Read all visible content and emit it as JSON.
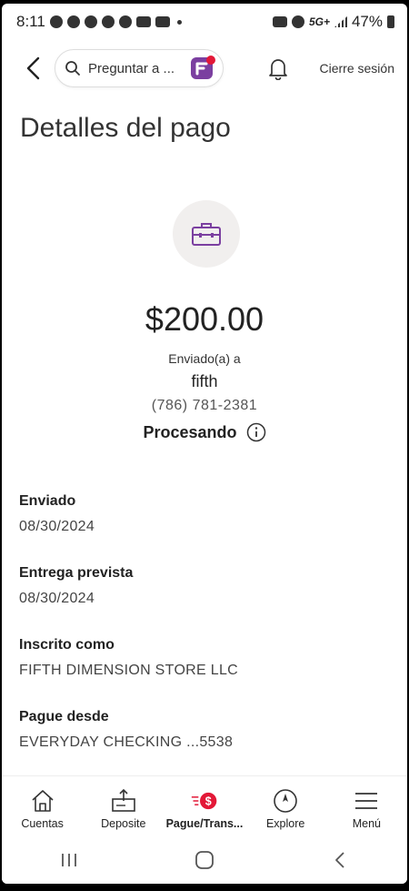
{
  "status_bar": {
    "time": "8:11",
    "network": "5G+",
    "battery": "47%"
  },
  "header": {
    "search_placeholder": "Preguntar a ...",
    "logout": "Cierre sesión"
  },
  "page": {
    "title": "Detalles del pago"
  },
  "payment": {
    "amount": "$200.00",
    "sent_to_label": "Enviado(a) a",
    "payee": "fifth",
    "phone": "(786) 781-2381",
    "status": "Procesando"
  },
  "details": [
    {
      "label": "Enviado",
      "value": "08/30/2024"
    },
    {
      "label": "Entrega prevista",
      "value": "08/30/2024"
    },
    {
      "label": "Inscrito como",
      "value": "FIFTH DIMENSION STORE LLC"
    },
    {
      "label": "Pague desde",
      "value": "EVERYDAY CHECKING ...5538"
    }
  ],
  "tabs": [
    {
      "label": "Cuentas",
      "icon": "house-icon"
    },
    {
      "label": "Deposite",
      "icon": "deposit-icon"
    },
    {
      "label": "Pague/Trans...",
      "icon": "pay-transfer-icon"
    },
    {
      "label": "Explore",
      "icon": "compass-icon"
    },
    {
      "label": "Menú",
      "icon": "hamburger-icon"
    }
  ],
  "colors": {
    "accent_purple": "#7b3fa0",
    "brand_red": "#e31837"
  }
}
